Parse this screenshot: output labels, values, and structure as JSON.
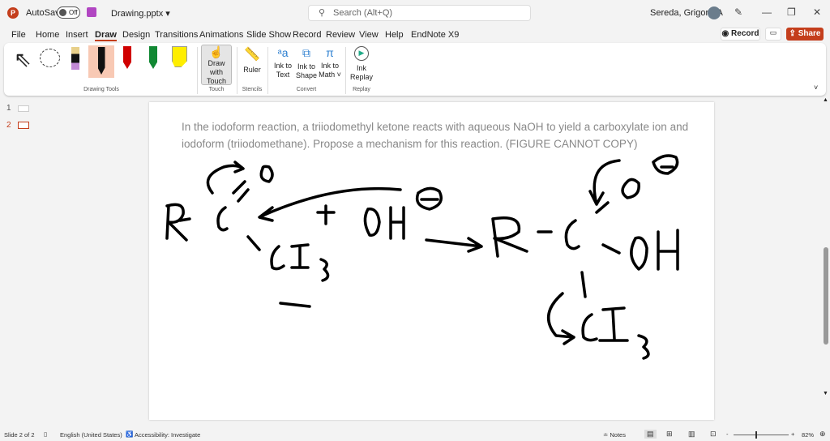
{
  "title": {
    "autosave": "AutoSave",
    "toggle": "Off",
    "filename": "Drawing.pptx ▾",
    "search_placeholder": "Search (Alt+Q)",
    "user": "Sereda, Grigoriy A"
  },
  "menu": [
    "File",
    "Home",
    "Insert",
    "Draw",
    "Design",
    "Transitions",
    "Animations",
    "Slide Show",
    "Record",
    "Review",
    "View",
    "Help",
    "EndNote X9"
  ],
  "actions": {
    "record": "Record",
    "share": "Share"
  },
  "ribbon": {
    "groups": [
      "Drawing Tools",
      "Touch",
      "Stencils",
      "Convert",
      "Replay"
    ],
    "draw_with_touch": [
      "Draw with",
      "Touch"
    ],
    "ruler": "Ruler",
    "ink_to_text": [
      "Ink to",
      "Text"
    ],
    "ink_to_shape": [
      "Ink to",
      "Shape"
    ],
    "ink_to_math": [
      "Ink to",
      "Math ˅"
    ],
    "ink_replay": [
      "Ink",
      "Replay"
    ],
    "pen_colors": [
      "#000000",
      "#d00000",
      "#118833",
      "#ffee00"
    ]
  },
  "thumbnails": [
    "1",
    "2"
  ],
  "slide": {
    "prompt": "In the iodoform reaction, a triiodomethyl ketone reacts with aqueous NaOH to yield a carboxylate ion and iodoform (triiodomethane). Propose a mechanism for this reaction. (FIGURE CANNOT COPY)"
  },
  "status": {
    "slide": "Slide 2 of 2",
    "language": "English (United States)",
    "accessibility": "Accessibility: Investigate",
    "notes": "Notes",
    "zoom": "82%"
  }
}
